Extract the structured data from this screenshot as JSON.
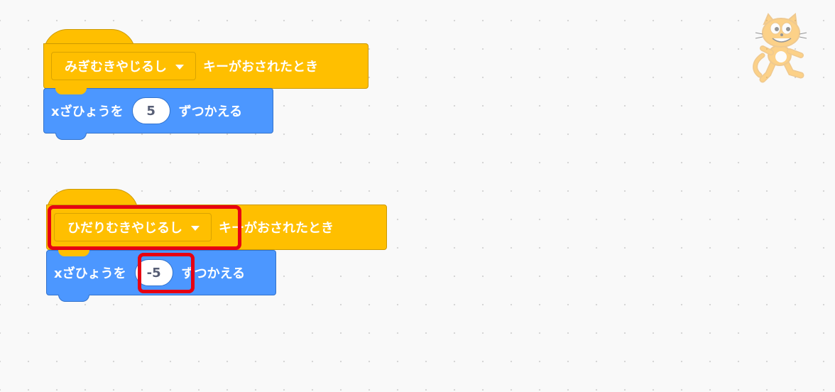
{
  "scripts": [
    {
      "hat": {
        "key_option": "みぎむきやじるし",
        "label": "キーがおされたとき"
      },
      "motion": {
        "prefix": "xざひょうを",
        "value": "5",
        "suffix": "ずつかえる"
      }
    },
    {
      "hat": {
        "key_option": "ひだりむきやじるし",
        "label": "キーがおされたとき"
      },
      "motion": {
        "prefix": "xざひょうを",
        "value": "-5",
        "suffix": "ずつかえる"
      }
    }
  ],
  "colors": {
    "events": "#ffbf00",
    "motion": "#4c97ff",
    "highlight": "#e60012",
    "background": "#f9f9f9"
  },
  "sprite": {
    "icon": "scratch-cat-icon"
  }
}
